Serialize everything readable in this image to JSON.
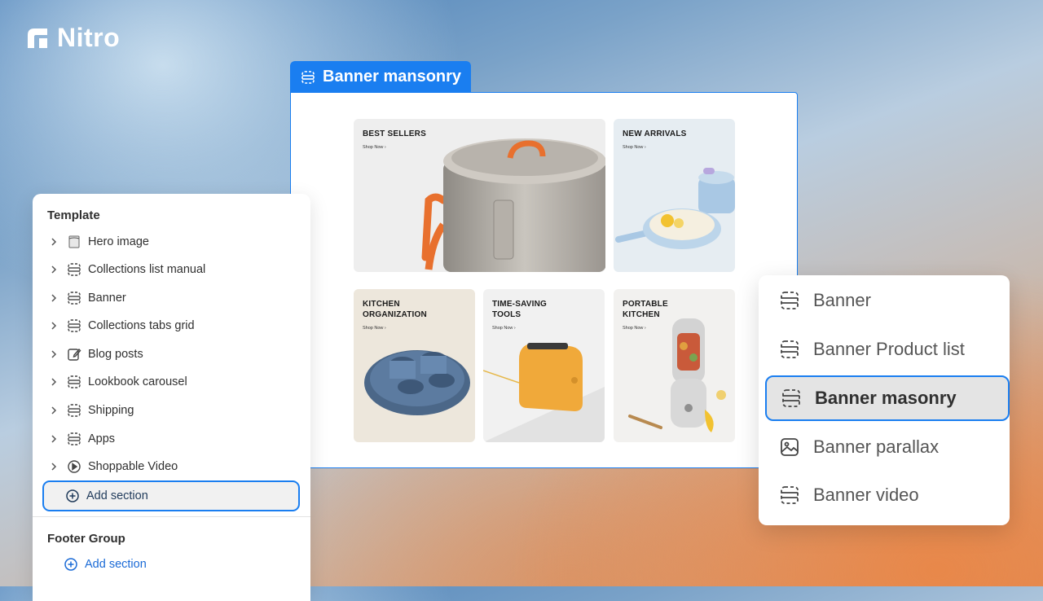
{
  "brand": {
    "name": "Nitro"
  },
  "preview": {
    "tag_label": "Banner mansonry",
    "tiles": [
      {
        "title": "BEST SELLERS",
        "link": "Shop Now  ›"
      },
      {
        "title": "NEW ARRIVALS",
        "link": "Shop Now  ›"
      },
      {
        "title": "KITCHEN\nORGANIZATION",
        "link": "Shop Now  ›"
      },
      {
        "title": "TIME-SAVING\nTOOLS",
        "link": "Shop Now  ›"
      },
      {
        "title": "PORTABLE\nKITCHEN",
        "link": "Shop Now  ›"
      }
    ]
  },
  "template_panel": {
    "heading": "Template",
    "items": [
      {
        "label": "Hero image",
        "icon": "hero-image-icon"
      },
      {
        "label": "Collections list manual",
        "icon": "section-icon"
      },
      {
        "label": "Banner",
        "icon": "section-icon"
      },
      {
        "label": "Collections tabs grid",
        "icon": "section-icon"
      },
      {
        "label": "Blog posts",
        "icon": "edit-icon"
      },
      {
        "label": "Lookbook carousel",
        "icon": "section-icon"
      },
      {
        "label": "Shipping",
        "icon": "section-icon"
      },
      {
        "label": "Apps",
        "icon": "section-icon"
      },
      {
        "label": "Shoppable Video",
        "icon": "play-icon"
      }
    ],
    "add_section_label": "Add section",
    "footer_heading": "Footer Group",
    "footer_add_label": "Add section"
  },
  "section_menu": {
    "items": [
      {
        "label": "Banner",
        "icon": "section-icon",
        "selected": false
      },
      {
        "label": "Banner Product list",
        "icon": "section-icon",
        "selected": false
      },
      {
        "label": "Banner masonry",
        "icon": "section-icon",
        "selected": true
      },
      {
        "label": "Banner parallax",
        "icon": "image-icon",
        "selected": false
      },
      {
        "label": "Banner video",
        "icon": "section-icon",
        "selected": false
      }
    ]
  },
  "colors": {
    "accent": "#1a7ef0",
    "panel_bg": "#ffffff"
  }
}
